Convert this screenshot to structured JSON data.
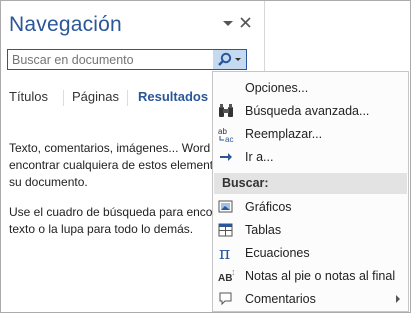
{
  "pane": {
    "title": "Navegación",
    "dropdown_icon": "triangle-down-icon",
    "close_icon": "close-icon"
  },
  "search": {
    "placeholder": "Buscar en documento",
    "button_icon": "magnifier-icon",
    "accent": "#2b579a",
    "button_bg": "#c5d9f1"
  },
  "tabs": [
    {
      "label": "Títulos",
      "active": false
    },
    {
      "label": "Páginas",
      "active": false
    },
    {
      "label": "Resultados",
      "active": true
    }
  ],
  "body": {
    "paragraph1": [
      "Texto, comentarios, imágenes... Word",
      "encontrar cualquiera de estos elemento",
      "su documento."
    ],
    "paragraph2": [
      "Use el cuadro de búsqueda para encon",
      "texto o la lupa para todo lo demás."
    ]
  },
  "menu": {
    "items_top": [
      {
        "label": "Opciones...",
        "icon": ""
      },
      {
        "label": "Búsqueda avanzada...",
        "icon": "binoculars-icon"
      },
      {
        "label": "Reemplazar...",
        "icon": "replace-icon"
      },
      {
        "label": "Ir a...",
        "icon": "arrow-right-icon"
      }
    ],
    "section_header": "Buscar:",
    "items_bottom": [
      {
        "label": "Gráficos",
        "icon": "graphics-icon"
      },
      {
        "label": "Tablas",
        "icon": "table-icon"
      },
      {
        "label": "Ecuaciones",
        "icon": "pi-icon"
      },
      {
        "label": "Notas al pie o notas al final",
        "icon": "footnote-icon"
      },
      {
        "label": "Comentarios",
        "icon": "comment-icon",
        "has_submenu": true
      }
    ]
  }
}
